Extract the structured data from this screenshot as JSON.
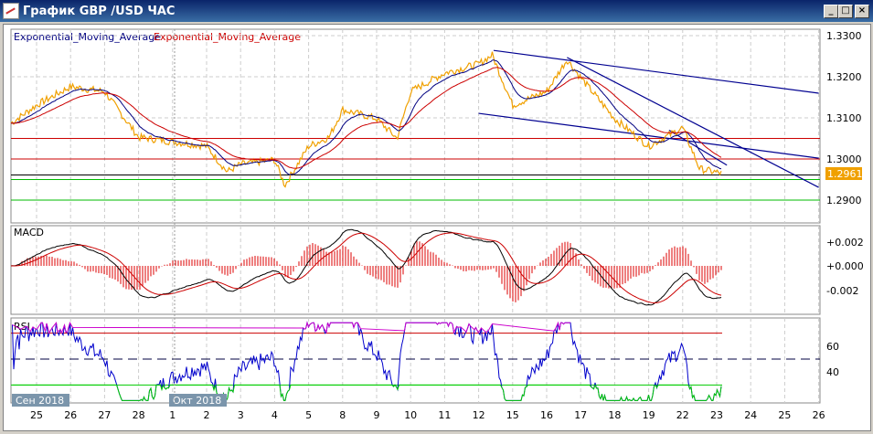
{
  "window": {
    "title": "График GBP /USD  ЧАС",
    "minimize": "_",
    "maximize": "□",
    "close": "×"
  },
  "legend": {
    "ema1": "Exponential_Moving_Average",
    "ema2": "Exponential_Moving_Average",
    "macd": "MACD",
    "rsi": "RSI"
  },
  "colors": {
    "price": "#f0a000",
    "ema_fast": "#000080",
    "ema_slow": "#cc0000",
    "hist": "#dd0000",
    "rsi": "#0000cc",
    "rsi_ob": "#cc00cc",
    "rsi_os": "#00cc00"
  },
  "chart_data": [
    {
      "type": "line",
      "title": "GBP/USD H1",
      "y_ticks": [
        "1.3300",
        "1.3200",
        "1.3100",
        "1.3000",
        "1.2900"
      ],
      "ylim": [
        1.288,
        1.3315
      ],
      "current_price": "1.2961",
      "price_anchors": [
        [
          -0.75,
          1.3087
        ],
        [
          0,
          1.3131
        ],
        [
          1,
          1.3176
        ],
        [
          2,
          1.3164
        ],
        [
          3,
          1.3053
        ],
        [
          4,
          1.3042
        ],
        [
          5,
          1.3031
        ],
        [
          5.6,
          1.2969
        ],
        [
          6,
          1.2987
        ],
        [
          7,
          1.2998
        ],
        [
          7.3,
          1.2936
        ],
        [
          8,
          1.3031
        ],
        [
          8.6,
          1.3053
        ],
        [
          9,
          1.312
        ],
        [
          10,
          1.3098
        ],
        [
          10.6,
          1.305
        ],
        [
          11,
          1.3164
        ],
        [
          12,
          1.3209
        ],
        [
          13,
          1.3231
        ],
        [
          13.4,
          1.3253
        ],
        [
          14,
          1.3131
        ],
        [
          15,
          1.3164
        ],
        [
          15.6,
          1.3242
        ],
        [
          16,
          1.3198
        ],
        [
          17,
          1.3098
        ],
        [
          18,
          1.3031
        ],
        [
          19,
          1.3076
        ],
        [
          19.5,
          1.2976
        ],
        [
          20.2,
          1.2964
        ]
      ],
      "hlines": [
        {
          "value": 1.305,
          "color": "#cc0000"
        },
        {
          "value": 1.3,
          "color": "#cc0000"
        },
        {
          "value": 1.2961,
          "color": "#000000"
        },
        {
          "value": 1.295,
          "color": "#00bb00"
        },
        {
          "value": 1.29,
          "color": "#00bb00"
        }
      ],
      "trendlines": [
        [
          13.44,
          1.3264,
          23,
          1.316
        ],
        [
          13,
          1.3111,
          23,
          1.3002
        ],
        [
          15.6,
          1.3247,
          23,
          1.2931
        ],
        [
          18.6,
          1.307,
          20.3,
          1.2985
        ]
      ]
    },
    {
      "type": "line",
      "title": "MACD",
      "y_ticks": [
        "+0.002",
        "+0.000",
        "-0.002"
      ]
    },
    {
      "type": "line",
      "title": "RSI",
      "y_ticks": [
        "60",
        "40"
      ],
      "levels": [
        70,
        50,
        30
      ]
    }
  ],
  "x_labels": [
    "25",
    "26",
    "27",
    "28",
    "1",
    "2",
    "3",
    "4",
    "5",
    "8",
    "9",
    "10",
    "11",
    "12",
    "15",
    "16",
    "17",
    "18",
    "19",
    "22",
    "23",
    "24",
    "25",
    "26"
  ],
  "month_labels": [
    {
      "label": "Сен 2018",
      "index": 0
    },
    {
      "label": "Окт 2018",
      "index": 4
    }
  ]
}
